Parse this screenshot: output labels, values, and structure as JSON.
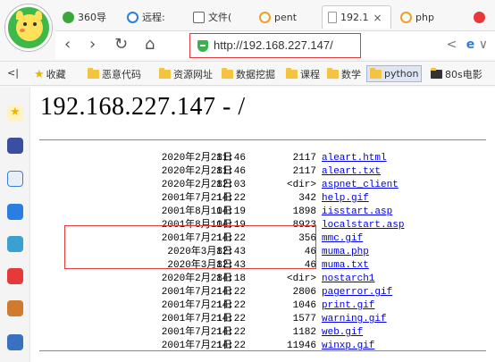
{
  "browser": {
    "tabs": [
      {
        "label": "360导",
        "icon": "360-icon",
        "color": "#3aa73a"
      },
      {
        "label": "远程:",
        "icon": "search-tab-icon",
        "color": "#2a7de1"
      },
      {
        "label": "文件(",
        "icon": "file-tab-icon",
        "color": "#666666"
      },
      {
        "label": "pent",
        "icon": "search-tab-icon",
        "color": "#f0a020"
      },
      {
        "label": "192.1",
        "icon": "page-icon",
        "color": "#999999"
      },
      {
        "label": "php",
        "icon": "search-tab-icon",
        "color": "#f0a020"
      }
    ],
    "active_tab_close": "×",
    "address_url": "http://192.168.227.147/",
    "nav_symbols": {
      "back": "‹",
      "forward": "›",
      "reload": "↻",
      "home": "⌂",
      "share": "<",
      "engine": "e",
      "menu": "∨"
    },
    "bookmarks": [
      "收藏",
      "恶意代码",
      "资源网址",
      "数据挖掘",
      "课程",
      "数学",
      "python",
      "80s电影"
    ],
    "bookmarks_toggle": "<|"
  },
  "page": {
    "title": "192.168.227.147 - /",
    "entries": [
      {
        "date": "2020年2月28日",
        "time": "11:46",
        "size": "2117",
        "name": "aleart.html"
      },
      {
        "date": "2020年2月28日",
        "time": "11:46",
        "size": "2117",
        "name": "aleart.txt"
      },
      {
        "date": "2020年2月28日",
        "time": "12:03",
        "size": "<dir>",
        "name": "aspnet_client"
      },
      {
        "date": "2001年7月21日",
        "time": "14:22",
        "size": "342",
        "name": "help.gif"
      },
      {
        "date": "2001年8月10日",
        "time": "14:19",
        "size": "1898",
        "name": "iisstart.asp"
      },
      {
        "date": "2001年8月10日",
        "time": "14:19",
        "size": "8923",
        "name": "localstart.asp"
      },
      {
        "date": "2001年7月21日",
        "time": "14:22",
        "size": "356",
        "name": "mmc.gif"
      },
      {
        "date": "2020年3月8日",
        "time": "12:43",
        "size": "46",
        "name": "muma.php"
      },
      {
        "date": "2020年3月8日",
        "time": "12:43",
        "size": "46",
        "name": "muma.txt"
      },
      {
        "date": "2020年2月28日",
        "time": "14:18",
        "size": "<dir>",
        "name": "nostarch1"
      },
      {
        "date": "2001年7月21日",
        "time": "14:22",
        "size": "2806",
        "name": "pagerror.gif"
      },
      {
        "date": "2001年7月21日",
        "time": "14:22",
        "size": "1046",
        "name": "print.gif"
      },
      {
        "date": "2001年7月21日",
        "time": "14:22",
        "size": "1577",
        "name": "warning.gif"
      },
      {
        "date": "2001年7月21日",
        "time": "14:22",
        "size": "1182",
        "name": "web.gif"
      },
      {
        "date": "2001年7月21日",
        "time": "14:22",
        "size": "11946",
        "name": "winxp.gif"
      }
    ]
  },
  "sidebar_icons": [
    {
      "name": "favorites-icon",
      "color": "#f0b400"
    },
    {
      "name": "news-icon",
      "color": "#3a4fa0"
    },
    {
      "name": "notes-icon",
      "color": "#3a7de0"
    },
    {
      "name": "chat-icon",
      "color": "#2a7de1"
    },
    {
      "name": "game-icon",
      "color": "#3aa0d0"
    },
    {
      "name": "red-app-icon",
      "color": "#e63a3a"
    },
    {
      "name": "game2-icon",
      "color": "#d07a30"
    },
    {
      "name": "game3-icon",
      "color": "#3a70c0"
    }
  ]
}
